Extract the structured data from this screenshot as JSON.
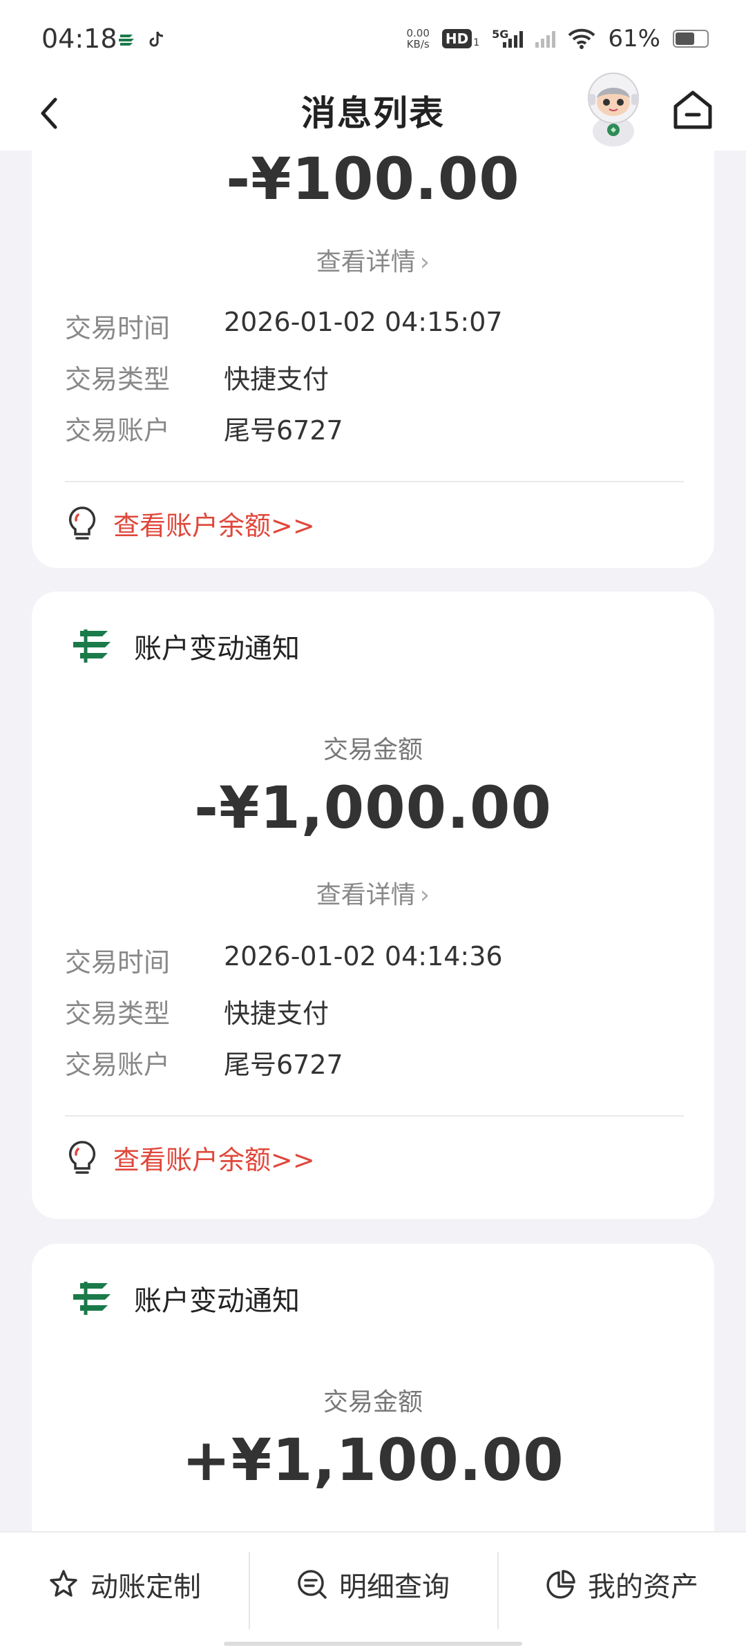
{
  "status_bar": {
    "time": "04:18",
    "network_speed_value": "0.00",
    "network_speed_unit": "KB/s",
    "hd_label": "HD",
    "hd_sub": "1",
    "network_type": "5G",
    "battery_text": "61%",
    "battery_level": 0.61
  },
  "nav": {
    "title": "消息列表"
  },
  "cards": [
    {
      "amount": "-¥100.00",
      "detail_link": "查看详情",
      "rows": [
        {
          "key": "交易时间",
          "value": "2026-01-02 04:15:07"
        },
        {
          "key": "交易类型",
          "value": "快捷支付"
        },
        {
          "key": "交易账户",
          "value": "尾号6727"
        }
      ],
      "balance_link": "查看账户余额>>"
    },
    {
      "title": "账户变动通知",
      "amount_label": "交易金额",
      "amount": "-¥1,000.00",
      "detail_link": "查看详情",
      "rows": [
        {
          "key": "交易时间",
          "value": "2026-01-02 04:14:36"
        },
        {
          "key": "交易类型",
          "value": "快捷支付"
        },
        {
          "key": "交易账户",
          "value": "尾号6727"
        }
      ],
      "balance_link": "查看账户余额>>"
    },
    {
      "title": "账户变动通知",
      "amount_label": "交易金额",
      "amount": "+¥1,100.00"
    }
  ],
  "tabs": [
    {
      "label": "动账定制",
      "icon": "star-badge-icon"
    },
    {
      "label": "明细查询",
      "icon": "search-list-icon"
    },
    {
      "label": "我的资产",
      "icon": "pie-chart-icon"
    }
  ],
  "colors": {
    "accent_red": "#e0473a",
    "logo_green": "#1a7a4a",
    "background": "#f2f2f7"
  }
}
